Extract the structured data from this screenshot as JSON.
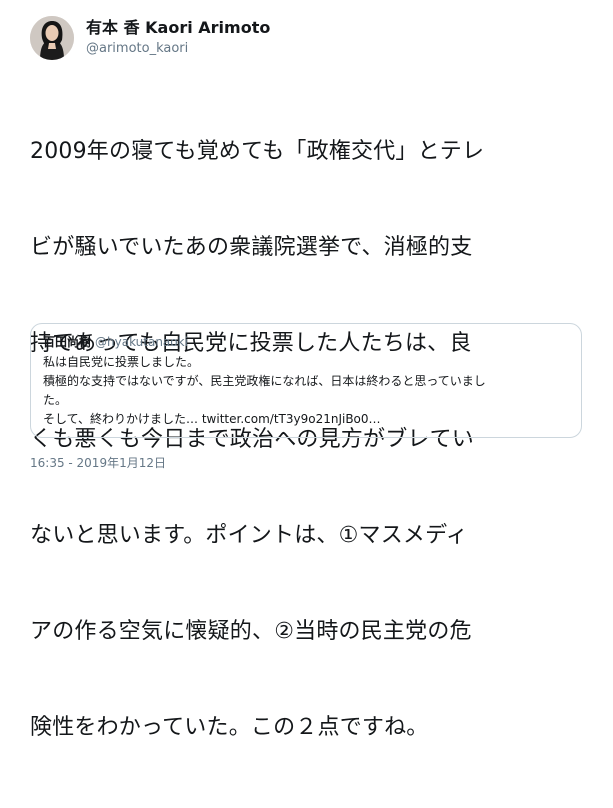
{
  "author": {
    "display_name": "有本 香 Kaori Arimoto",
    "handle": "@arimoto_kaori"
  },
  "tweet": {
    "text": "2009年の寝ても覚めても「政権交代」とテレビが騒いでいたあの衆議院選挙で、消極的支持であっても自民党に投票した人たちは、良くも悪くも今日まで政治への見方がブレていないと思います。ポイントは、①マスメディアの作る空気に懐疑的、②当時の民主党の危険性をわかっていた。この２点ですね。",
    "lines": [
      "2009年の寝ても覚めても「政権交代」とテレ",
      "ビが騒いでいたあの衆議院選挙で、消極的支",
      "持であっても自民党に投票した人たちは、良",
      "くも悪くも今日まで政治への見方がブレてい",
      "ないと思います。ポイントは、①マスメディ",
      "アの作る空気に懐疑的、②当時の民主党の危",
      "険性をわかっていた。この２点ですね。"
    ]
  },
  "quoted_tweet": {
    "display_name": "百田尚樹",
    "handle": "@hyakutanaoki",
    "lines": [
      "私は自民党に投票しました。",
      "積極的な支持ではないですが、民主党政権になれば、日本は終わると思っていまし",
      "た。",
      "そして、終わりかけました… twitter.com/tT3y9o21nJiBo0…"
    ]
  },
  "timestamp": "16:35 - 2019年1月12日"
}
